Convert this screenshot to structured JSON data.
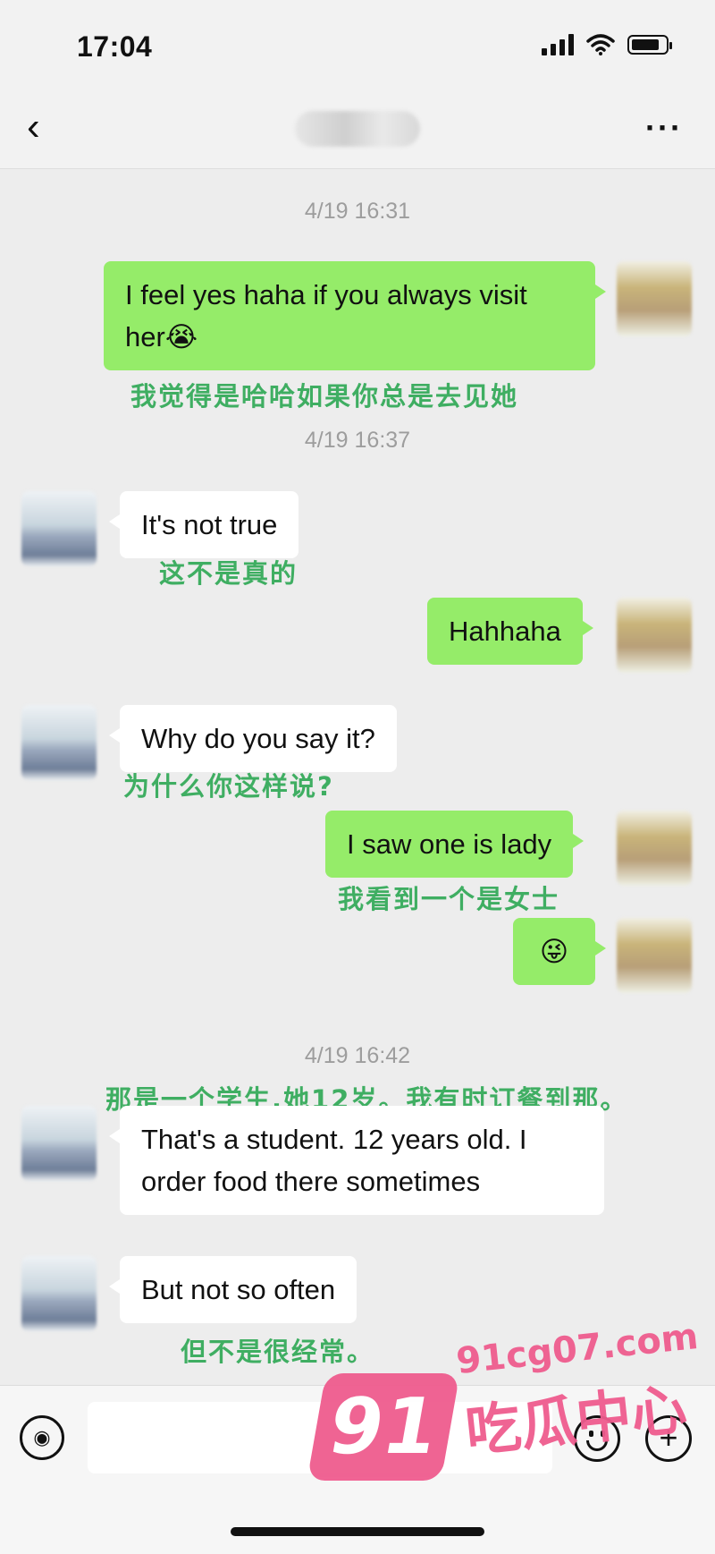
{
  "status": {
    "time": "17:04"
  },
  "nav": {
    "back": "‹",
    "title": "",
    "more": "···"
  },
  "messages": [
    {
      "timestamp": "4/19 16:31"
    },
    {
      "text": "I feel yes haha if you always visit her",
      "emoji": "😭",
      "translation": "我觉得是哈哈如果你总是去见她"
    },
    {
      "timestamp": "4/19 16:37"
    },
    {
      "text": "It's not true",
      "translation": "这不是真的"
    },
    {
      "text": "Hahhaha"
    },
    {
      "text": "Why do you say it?",
      "translation": "为什么你这样说?"
    },
    {
      "text": "I saw one is lady",
      "translation": "我看到一个是女士"
    },
    {
      "emoji": "😜"
    },
    {
      "timestamp": "4/19 16:42"
    },
    {
      "translation": "那是一个学生,她12岁。我有时订餐到那。"
    },
    {
      "text": "That's a student. 12 years old. I order food there sometimes"
    },
    {
      "text": "But not so often",
      "translation": "但不是很经常。"
    }
  ],
  "input": {
    "placeholder": ""
  },
  "watermark": {
    "badge": "91",
    "url": "91cg07.com",
    "name": "吃瓜中心"
  }
}
